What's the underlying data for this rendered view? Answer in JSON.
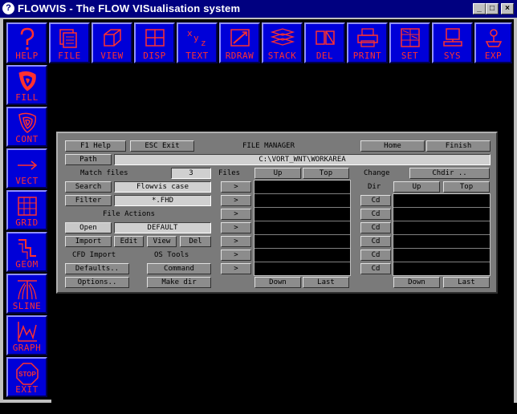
{
  "window": {
    "title": "FLOWVIS - The FLOW VISualisation system",
    "minimize": "_",
    "maximize": "□",
    "close": "×"
  },
  "toolbar": {
    "top": [
      {
        "label": "HELP",
        "icon": "question-mark-icon"
      },
      {
        "label": "FILE",
        "icon": "file-icon"
      },
      {
        "label": "VIEW",
        "icon": "cube-icon"
      },
      {
        "label": "DISP",
        "icon": "window-grid-icon"
      },
      {
        "label": "TEXT",
        "icon": "xyz-text-icon"
      },
      {
        "label": "RDRAW",
        "icon": "redraw-icon"
      },
      {
        "label": "STACK",
        "icon": "stack-icon"
      },
      {
        "label": "DEL",
        "icon": "delete-icon"
      },
      {
        "label": "PRINT",
        "icon": "printer-icon"
      },
      {
        "label": "SET",
        "icon": "settings-grid-icon"
      },
      {
        "label": "SYS",
        "icon": "computer-icon"
      },
      {
        "label": "EXP",
        "icon": "export-icon"
      }
    ],
    "left": [
      {
        "label": "FILL",
        "icon": "fill-contour-icon"
      },
      {
        "label": "CONT",
        "icon": "contour-icon"
      },
      {
        "label": "VECT",
        "icon": "vector-arrow-icon"
      },
      {
        "label": "GRID",
        "icon": "grid-icon"
      },
      {
        "label": "GEOM",
        "icon": "geometry-icon"
      },
      {
        "label": "SLINE",
        "icon": "streamline-icon"
      },
      {
        "label": "GRAPH",
        "icon": "graph-icon"
      },
      {
        "label": "EXIT",
        "icon": "stop-sign-icon"
      }
    ],
    "exit_sign_text": "STOP"
  },
  "file_manager": {
    "title": "FILE MANAGER",
    "f1_help": "F1 Help",
    "esc_exit": "ESC Exit",
    "home": "Home",
    "finish": "Finish",
    "path_label": "Path",
    "path_value": "C:\\VORT_WNT\\WORKAREA",
    "match_files_label": "Match files",
    "match_files_value": "3",
    "files_label": "Files",
    "files_up": "Up",
    "files_top": "Top",
    "change_label": "Change",
    "chdir": "Chdir ..",
    "search": "Search",
    "search_value": "Flowvis case",
    "filter": "Filter",
    "filter_value": "*.FHD",
    "file_actions": "File Actions",
    "open": "Open",
    "open_value": "DEFAULT",
    "import": "Import",
    "edit": "Edit",
    "view": "View",
    "del": "Del",
    "cfd_import": "CFD Import",
    "os_tools": "OS Tools",
    "defaults": "Defaults..",
    "command": "Command",
    "options": "Options..",
    "make_dir": "Make dir",
    "select_arrow": ">",
    "dir_label": "Dir",
    "dir_up": "Up",
    "dir_top": "Top",
    "cd": "Cd",
    "files_down": "Down",
    "files_last": "Last",
    "dir_down": "Down",
    "dir_last": "Last"
  },
  "colors": {
    "toolbar_bg": "#0000d8",
    "toolbar_fg": "#ff3030",
    "dialog_bg": "#7a7a7a",
    "titlebar": "#000080"
  }
}
